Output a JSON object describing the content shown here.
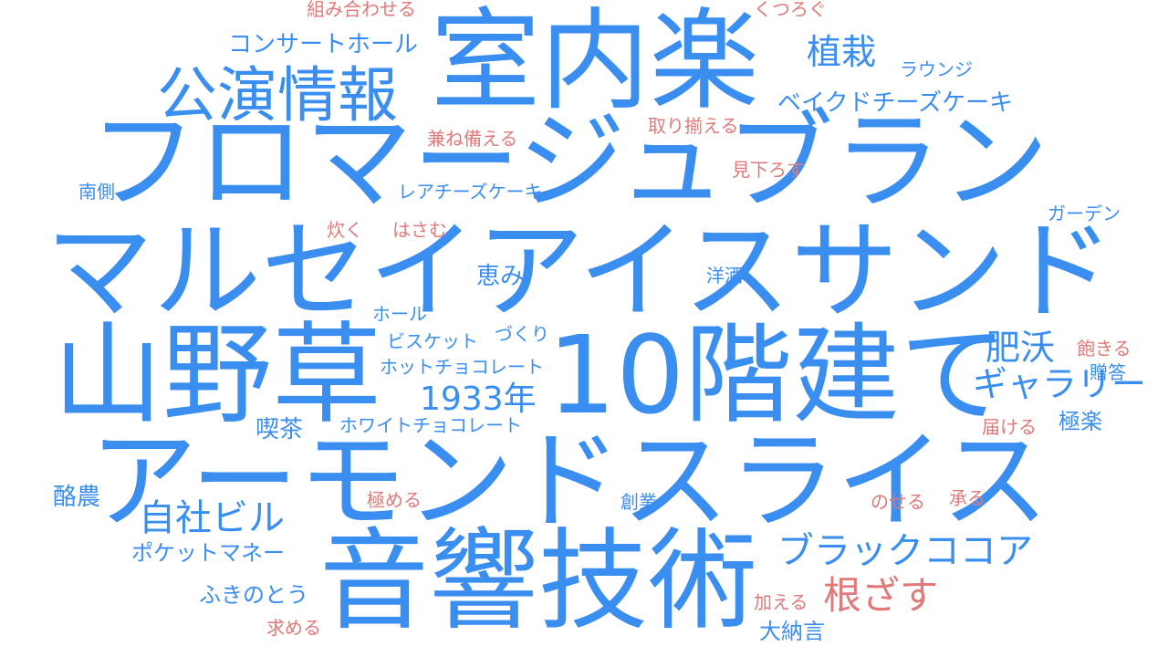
{
  "word_cloud": {
    "colors": {
      "primary": "#3a8ef0",
      "secondary": "#e07a7a",
      "background": "#ffffff"
    },
    "words": [
      "室内楽",
      "フロマージュブラン",
      "マルセイアイスサンド",
      "山野草",
      "10階建て",
      "アーモンドスライス",
      "音響技術",
      "公演情報",
      "植栽",
      "コンサートホール",
      "ベイクドチーズケーキ",
      "肥沃",
      "ギャラリー",
      "1933年",
      "自社ビル",
      "ブラックココア",
      "根ざす",
      "レアチーズケーキ",
      "ホットチョコレート",
      "ホワイトチョコレート",
      "ポケットマネー",
      "ふきのとう",
      "ビスケット",
      "づくり",
      "ホール",
      "恵み",
      "喫茶",
      "酪農",
      "極楽",
      "ガーデン",
      "ラウンジ",
      "南側",
      "洋酒",
      "大納言",
      "創業",
      "贈答",
      "組み合わせる",
      "くつろぐ",
      "取り揃える",
      "兼ね備える",
      "見下ろす",
      "炊く",
      "はさむ",
      "飽きる",
      "届ける",
      "極める",
      "のせる",
      "承る",
      "加える",
      "求める"
    ]
  }
}
